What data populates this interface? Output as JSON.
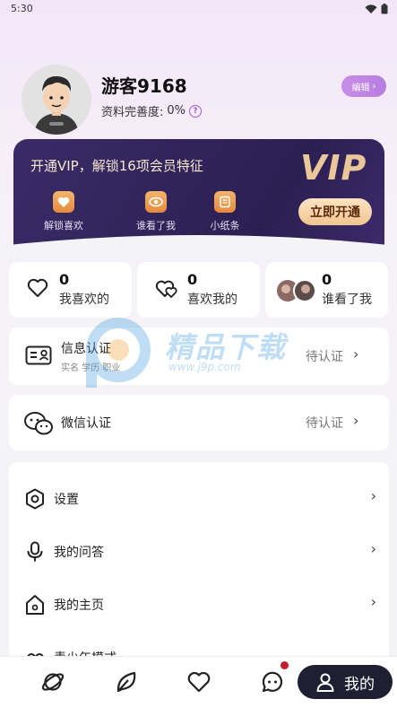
{
  "status_bar": {
    "time": "5:30"
  },
  "profile": {
    "username": "游客9168",
    "completeness_label": "资料完善度:",
    "completeness_value": "0%",
    "help_glyph": "?",
    "edit_label": "编辑",
    "edit_chevron": "›"
  },
  "vip": {
    "title": "开通VIP，解锁16项会员特征",
    "logo": "VIP",
    "features": [
      {
        "label": "解锁喜欢",
        "icon": "heart-icon"
      },
      {
        "label": "谁看了我",
        "icon": "eye-icon"
      },
      {
        "label": "小纸条",
        "icon": "note-icon"
      }
    ],
    "open_button": "立即开通"
  },
  "stats": [
    {
      "count": "0",
      "label": "我喜欢的",
      "icon": "heart-outline-icon"
    },
    {
      "count": "0",
      "label": "喜欢我的",
      "icon": "double-heart-icon"
    },
    {
      "count": "0",
      "label": "谁看了我",
      "icon": "visitor-avatars-icon"
    }
  ],
  "verifications": [
    {
      "title": "信息认证",
      "subtitle": "实名 学历 职业",
      "status": "待认证",
      "icon": "id-card-icon"
    },
    {
      "title": "微信认证",
      "subtitle": "",
      "status": "待认证",
      "icon": "wechat-icon"
    }
  ],
  "menu": [
    {
      "label": "设置",
      "icon": "settings-hexagon-icon"
    },
    {
      "label": "我的问答",
      "icon": "microphone-icon"
    },
    {
      "label": "我的主页",
      "icon": "home-icon"
    },
    {
      "label": "青少年模式",
      "icon": "youth-mode-icon"
    }
  ],
  "watermark": {
    "text": "精品下载",
    "url": "www.j9p.com"
  },
  "bottom_nav": {
    "items": [
      {
        "name": "planet",
        "icon": "planet-icon"
      },
      {
        "name": "leaf",
        "icon": "leaf-icon"
      },
      {
        "name": "heart",
        "icon": "heart-icon"
      },
      {
        "name": "chat",
        "icon": "chat-bubble-icon",
        "badge": true
      },
      {
        "name": "mine",
        "icon": "person-icon",
        "label": "我的",
        "active": true
      }
    ]
  },
  "colors": {
    "accent_purple": "#b67de0",
    "vip_dark": "#2b1f52",
    "vip_gold": "#e9c79b",
    "nav_active": "#1f1f33",
    "badge_red": "#c21f2e"
  }
}
